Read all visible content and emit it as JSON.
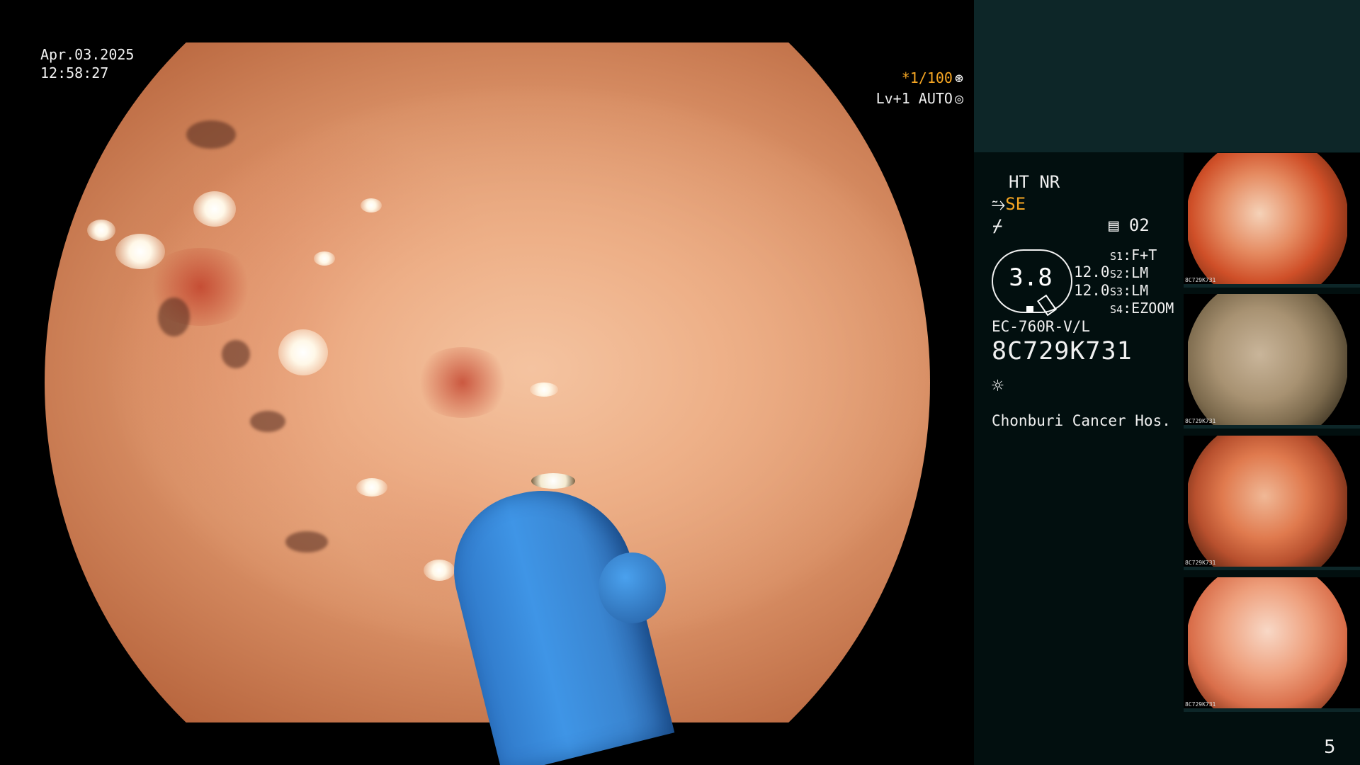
{
  "overlay": {
    "date": "Apr.03.2025",
    "time": "12:58:27",
    "shutter": "*1/100",
    "enhancement_mode": "Lv+1 AUTO",
    "shutter_icon": "aperture-icon",
    "mode_icon": "iris-icon"
  },
  "panel": {
    "processing_flags": "HT NR",
    "structure_icon": "structure-enhance-icon",
    "structure_mode": "SE",
    "color_icon": "color-enhance-icon",
    "memo_icon": "memo-icon",
    "memo_count": "02",
    "zoom_value": "3.8",
    "value_1": "12.0",
    "value_2": "12.0",
    "scope_settings": [
      {
        "key": "S1",
        "value": "F+T"
      },
      {
        "key": "S2",
        "value": "LM"
      },
      {
        "key": "S3",
        "value": "LM"
      },
      {
        "key": "S4",
        "value": "EZOOM"
      }
    ],
    "scope_model": "EC-760R-V/L",
    "scope_serial": "8C729K731",
    "light_icon": "light-source-icon",
    "hospital": "Chonburi Cancer Hos."
  },
  "thumbnails": [
    {
      "serial": "8C729K731"
    },
    {
      "serial": "8C729K731"
    },
    {
      "serial": "8C729K731"
    },
    {
      "serial": "8C729K731"
    }
  ],
  "page_number": "5",
  "colors": {
    "accent_orange": "#f6a623",
    "panel_top": "#0d2628",
    "panel_bg": "#020f0f",
    "instrument_blue": "#3f95e6"
  }
}
